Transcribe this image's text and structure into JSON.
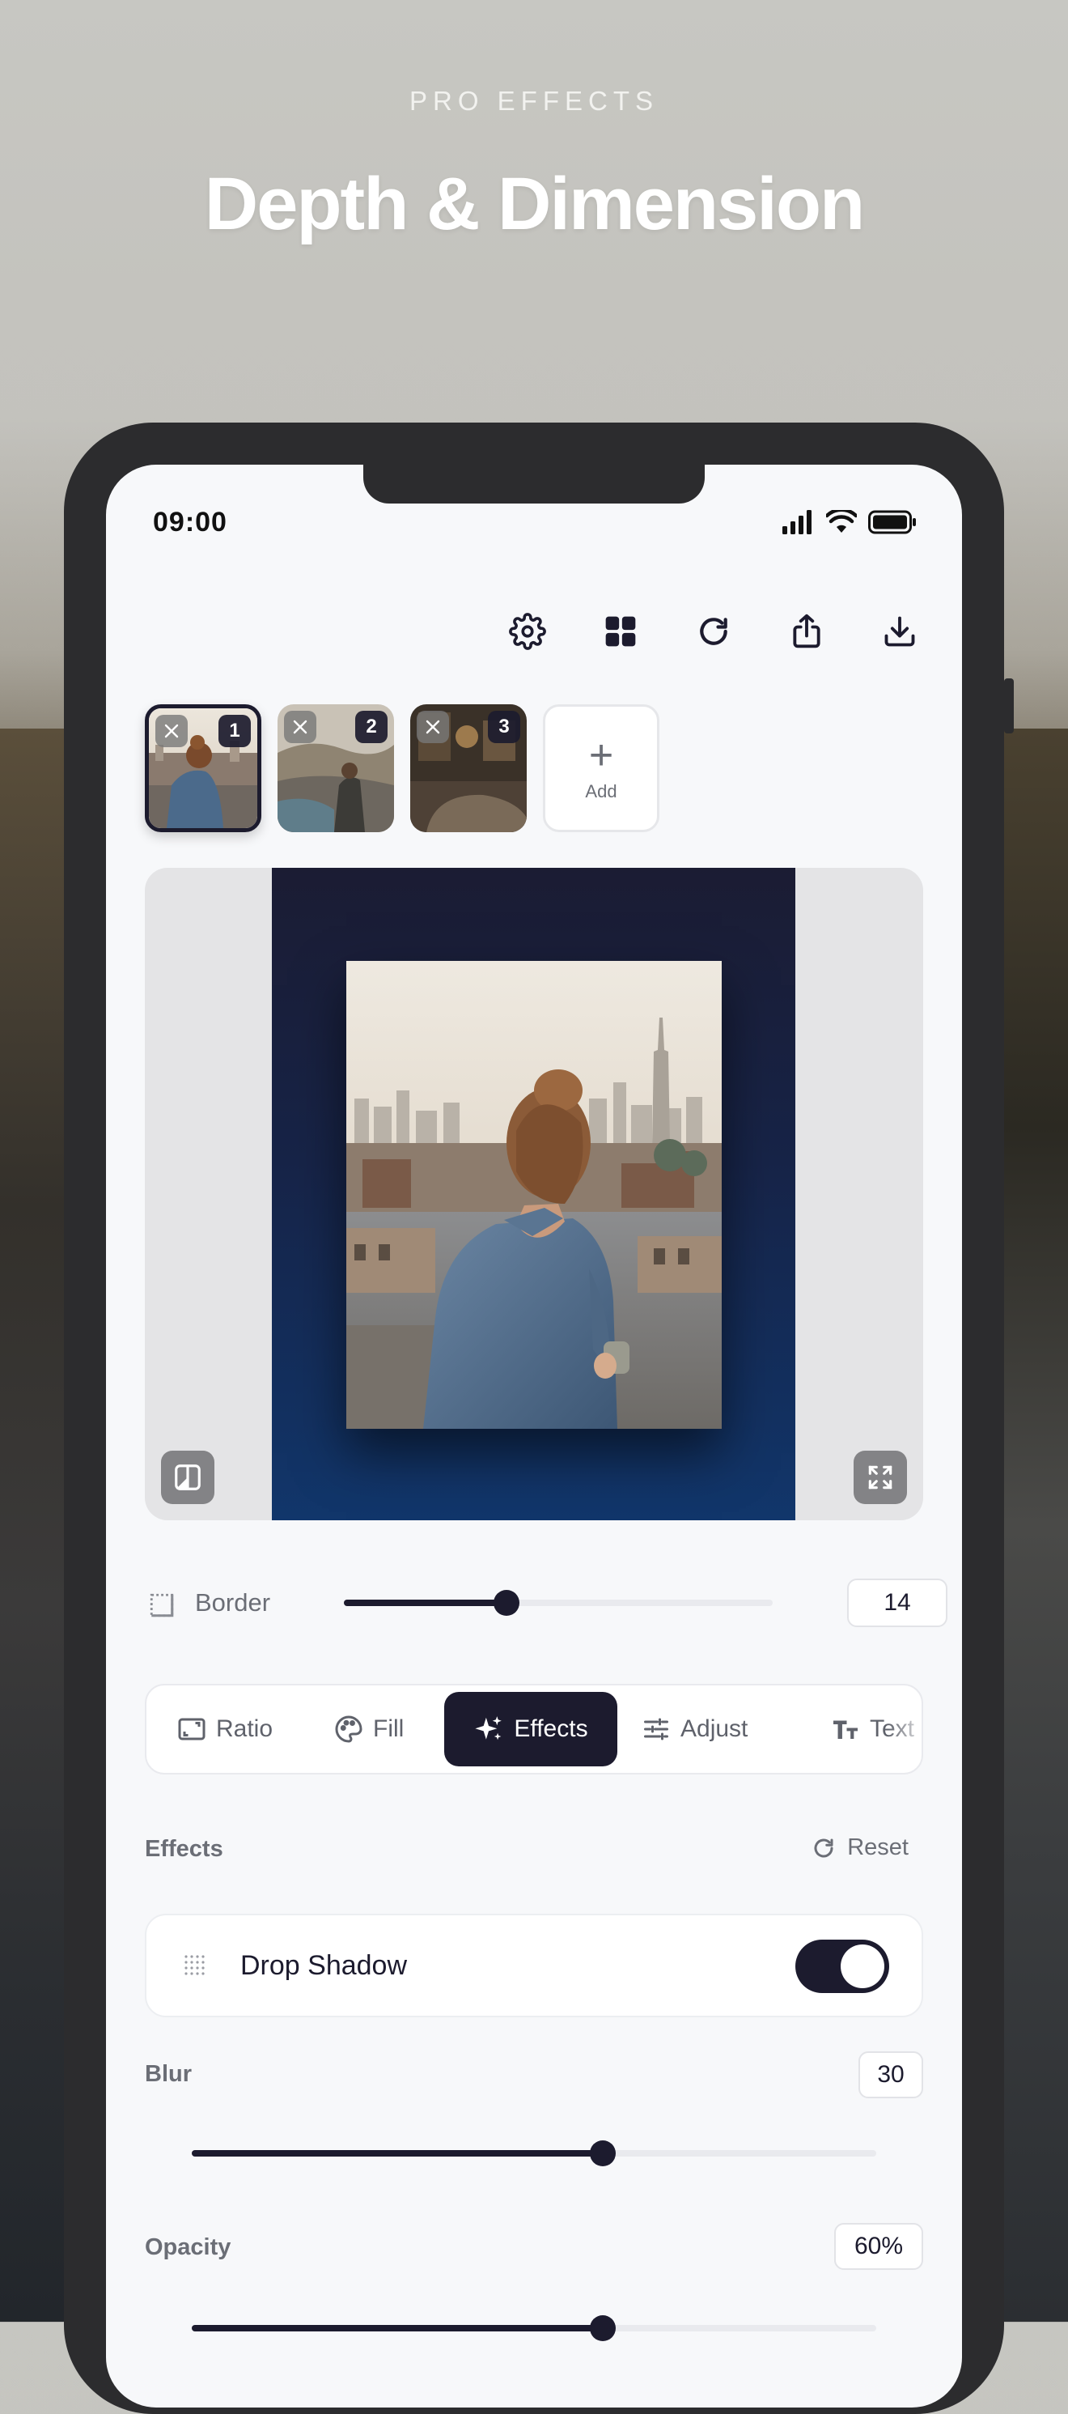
{
  "hero": {
    "eyebrow": "PRO EFFECTS",
    "headline": "Depth & Dimension"
  },
  "status_bar": {
    "time": "09:00",
    "icons": [
      "signal-icon",
      "wifi-icon",
      "battery-icon"
    ]
  },
  "toolbar": {
    "buttons": [
      "gear-icon",
      "grid-icon",
      "refresh-icon",
      "share-icon",
      "download-icon"
    ]
  },
  "thumbnails": {
    "items": [
      {
        "number": "1",
        "selected": true
      },
      {
        "number": "2",
        "selected": false
      },
      {
        "number": "3",
        "selected": false
      }
    ],
    "add_label": "Add",
    "add_symbol": "+"
  },
  "border": {
    "label": "Border",
    "value": "14",
    "slider_fraction": 0.38
  },
  "tabs": {
    "items": [
      {
        "label": "Ratio",
        "icon": "ratio-icon"
      },
      {
        "label": "Fill",
        "icon": "palette-icon"
      },
      {
        "label": "Effects",
        "icon": "sparkles-icon",
        "active": true
      },
      {
        "label": "Adjust",
        "icon": "sliders-icon"
      },
      {
        "label": "Text",
        "icon": "text-icon"
      }
    ]
  },
  "effects": {
    "section_title": "Effects",
    "reset_label": "Reset",
    "drop_shadow": {
      "label": "Drop Shadow",
      "enabled": true
    },
    "blur": {
      "label": "Blur",
      "value": "30",
      "slider_fraction": 0.6
    },
    "opacity": {
      "label": "Opacity",
      "value": "60%",
      "slider_fraction": 0.6
    }
  },
  "colors": {
    "accent": "#1c1b2e",
    "frame_top": "#1b1c33",
    "frame_bottom": "#11366b",
    "screen_bg": "#f7f8fa"
  }
}
